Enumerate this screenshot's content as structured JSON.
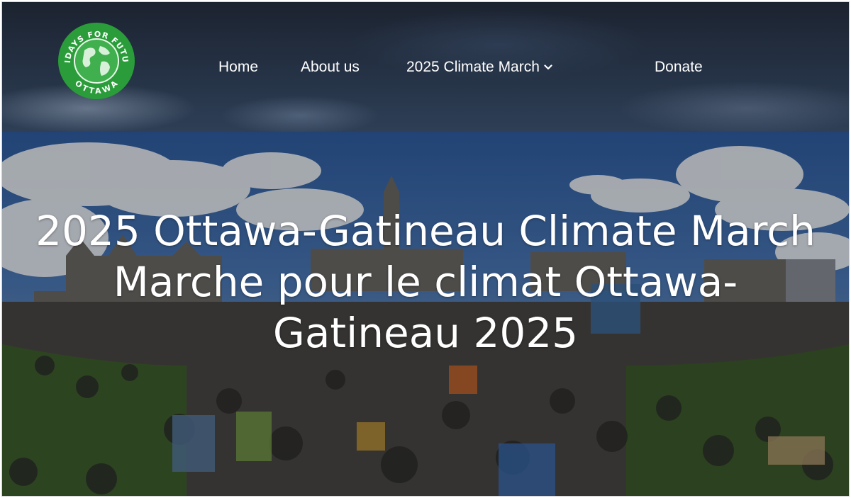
{
  "logo": {
    "text_top": "FRIDAYS FOR FUTURE",
    "text_bottom": "OTTAWA",
    "icon": "globe-icon",
    "color": "#2a9d3a"
  },
  "nav": {
    "items": [
      {
        "label": "Home"
      },
      {
        "label": "About us"
      },
      {
        "label": "2025 Climate March",
        "icon": "chevron-down-icon"
      },
      {
        "label": "Donate"
      }
    ]
  },
  "hero": {
    "title_en": "2025 Ottawa-Gatineau Climate March",
    "title_fr": "Marche pour le climat Ottawa-Gatineau 2025"
  }
}
